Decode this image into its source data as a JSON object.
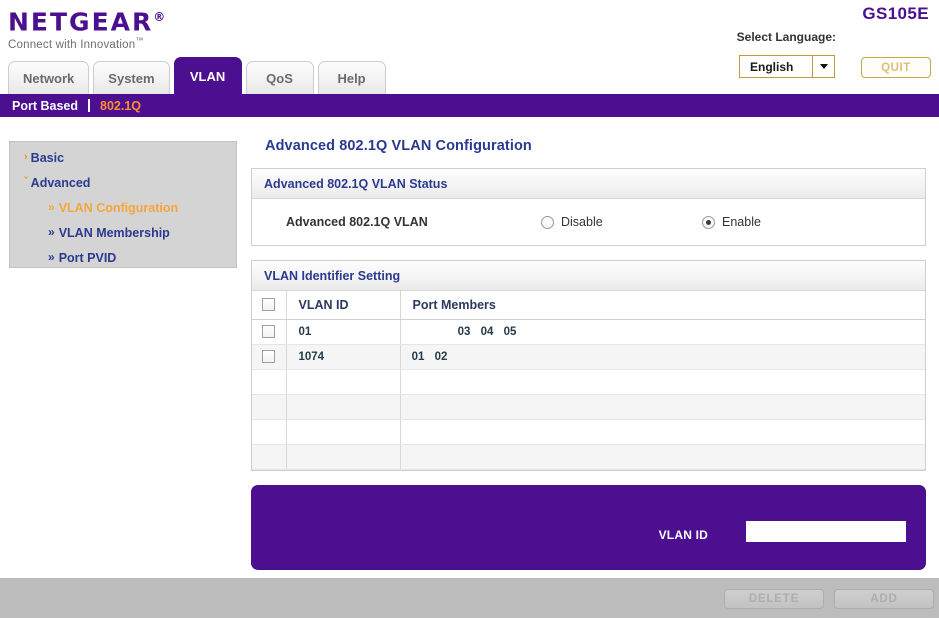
{
  "brand": {
    "name": "NETGEAR",
    "registered": "®",
    "tagline": "Connect with Innovation",
    "tm": "™",
    "model": "GS105E",
    "accent_purple": "#4b0f8f",
    "accent_orange": "#ff8c2b",
    "nav_blue": "#2b3a8f"
  },
  "header": {
    "language_label": "Select Language:",
    "language_value": "English",
    "language_options": [
      "English"
    ],
    "quit_label": "QUIT",
    "dropdown_icon": "chevron-down-icon"
  },
  "tabs": [
    {
      "label": "Network",
      "active": false
    },
    {
      "label": "System",
      "active": false
    },
    {
      "label": "VLAN",
      "active": true
    },
    {
      "label": "QoS",
      "active": false
    },
    {
      "label": "Help",
      "active": false
    }
  ],
  "subnav": {
    "items": [
      {
        "label": "Port Based",
        "active": false
      },
      {
        "label": "802.1Q",
        "active": true
      }
    ]
  },
  "sidebar": {
    "basic": {
      "label": "Basic",
      "marker": "›"
    },
    "advanced": {
      "label": "Advanced",
      "marker": "ˇ"
    },
    "sub_items": [
      {
        "label": "VLAN Configuration",
        "marker": "»",
        "selected": true
      },
      {
        "label": "VLAN Membership",
        "marker": "»",
        "selected": false
      },
      {
        "label": "Port PVID",
        "marker": "»",
        "selected": false
      }
    ]
  },
  "main": {
    "page_title": "Advanced 802.1Q VLAN Configuration",
    "status_panel": {
      "heading": "Advanced 802.1Q VLAN Status",
      "row_label": "Advanced 802.1Q VLAN",
      "disable_label": "Disable",
      "enable_label": "Enable",
      "disable_checked": false,
      "enable_checked": true
    },
    "identifier_panel": {
      "heading": "VLAN Identifier Setting",
      "columns": {
        "select_all": "",
        "vlan_id": "VLAN ID",
        "port_members": "Port Members"
      },
      "select_all_checked": false,
      "port_slot_count": 5,
      "rows": [
        {
          "checked": false,
          "vlan_id": "01",
          "ports": [
            "",
            "",
            "03",
            "04",
            "05"
          ]
        },
        {
          "checked": false,
          "vlan_id": "1074",
          "ports": [
            "01",
            "02",
            "",
            "",
            ""
          ]
        }
      ],
      "empty_row_count": 4
    },
    "add_panel": {
      "vlan_id_label": "VLAN ID",
      "vlan_id_value": "",
      "vlan_id_placeholder": ""
    }
  },
  "footer": {
    "delete_label": "DELETE",
    "add_label": "ADD",
    "delete_disabled": true,
    "add_disabled": true
  }
}
